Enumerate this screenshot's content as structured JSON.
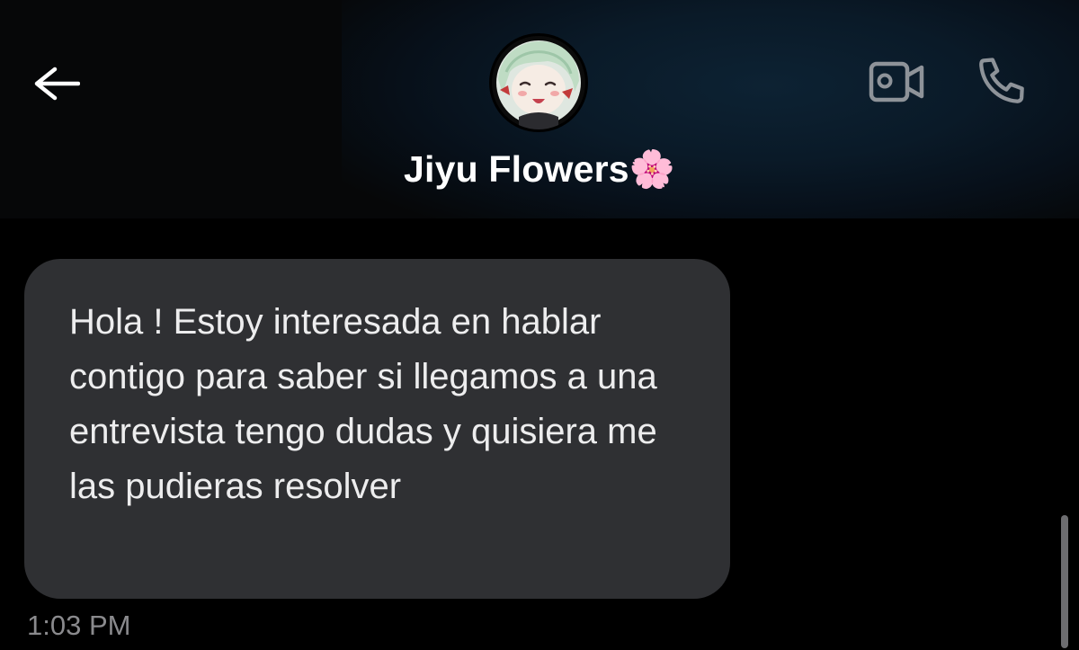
{
  "header": {
    "contact_name": "Jiyu Flowers🌸",
    "back_icon": "arrow-left-icon",
    "video_icon": "video-camera-icon",
    "call_icon": "phone-icon",
    "avatar": "contact-avatar"
  },
  "conversation": {
    "messages": [
      {
        "text": "Hola ! Estoy interesada en hablar contigo para saber si llegamos a una entrevista tengo dudas y quisiera me las pudieras resolver",
        "timestamp": "1:03 PM",
        "direction": "incoming"
      }
    ]
  },
  "colors": {
    "background": "#000000",
    "bubble": "#2f3033",
    "header_accent": "#0d2233",
    "icon": "#8e9399"
  }
}
